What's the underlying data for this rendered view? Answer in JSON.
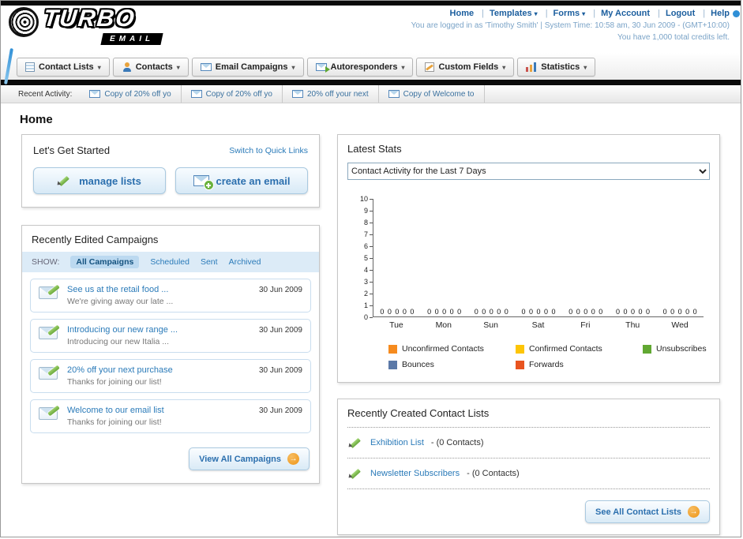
{
  "brand": {
    "name_top": "TURBO",
    "name_bottom": "EMAIL"
  },
  "top_nav": {
    "links": [
      {
        "label": "Home",
        "dropdown": false
      },
      {
        "label": "Templates",
        "dropdown": true
      },
      {
        "label": "Forms",
        "dropdown": true
      },
      {
        "label": "My Account",
        "dropdown": false
      },
      {
        "label": "Logout",
        "dropdown": false
      },
      {
        "label": "Help",
        "dropdown": false
      }
    ]
  },
  "session": {
    "line1": "You are logged in as 'Timothy Smith' | System Time: 10:58 am, 30 Jun 2009 - (GMT+10:00)",
    "line2": "You have 1,000 total credits left."
  },
  "main_nav": {
    "tabs": [
      {
        "label": "Contact Lists",
        "icon": "contact-lists-icon"
      },
      {
        "label": "Contacts",
        "icon": "contacts-icon"
      },
      {
        "label": "Email Campaigns",
        "icon": "email-campaigns-icon"
      },
      {
        "label": "Autoresponders",
        "icon": "autoresponders-icon"
      },
      {
        "label": "Custom Fields",
        "icon": "custom-fields-icon"
      },
      {
        "label": "Statistics",
        "icon": "statistics-icon"
      }
    ]
  },
  "recent_activity": {
    "label": "Recent Activity:",
    "items": [
      "Copy of 20% off yo",
      "Copy of 20% off yo",
      "20% off your next",
      "Copy of Welcome to"
    ]
  },
  "page": {
    "title": "Home"
  },
  "get_started": {
    "title": "Let's Get Started",
    "switch_link": "Switch to Quick Links",
    "manage_lists_label": "manage lists",
    "create_email_label": "create an email"
  },
  "campaigns": {
    "title": "Recently Edited Campaigns",
    "show_label": "SHOW:",
    "filters": [
      "All Campaigns",
      "Scheduled",
      "Sent",
      "Archived"
    ],
    "active_filter": "All Campaigns",
    "items": [
      {
        "title": "See us at the retail food ...",
        "subtitle": "We're giving away our late ...",
        "date": "30 Jun 2009"
      },
      {
        "title": "Introducing our new range ...",
        "subtitle": "Introducing our new Italia ...",
        "date": "30 Jun 2009"
      },
      {
        "title": "20% off your next purchase",
        "subtitle": "Thanks for joining our list!",
        "date": "30 Jun 2009"
      },
      {
        "title": "Welcome to our email list",
        "subtitle": "Thanks for joining our list!",
        "date": "30 Jun 2009"
      }
    ],
    "view_all_label": "View All Campaigns"
  },
  "stats": {
    "title": "Latest Stats",
    "selector_value": "Contact Activity for the Last 7 Days"
  },
  "chart_data": {
    "type": "bar",
    "title": "Contact Activity for the Last 7 Days",
    "categories": [
      "Tue",
      "Mon",
      "Sun",
      "Sat",
      "Fri",
      "Thu",
      "Wed"
    ],
    "series": [
      {
        "name": "Unconfirmed Contacts",
        "color": "#f68b1f",
        "values": [
          0,
          0,
          0,
          0,
          0,
          0,
          0
        ]
      },
      {
        "name": "Confirmed Contacts",
        "color": "#fdc506",
        "values": [
          0,
          0,
          0,
          0,
          0,
          0,
          0
        ]
      },
      {
        "name": "Unsubscribes",
        "color": "#61a832",
        "values": [
          0,
          0,
          0,
          0,
          0,
          0,
          0
        ]
      },
      {
        "name": "Bounces",
        "color": "#5b79a8",
        "values": [
          0,
          0,
          0,
          0,
          0,
          0,
          0
        ]
      },
      {
        "name": "Forwards",
        "color": "#e8541f",
        "values": [
          0,
          0,
          0,
          0,
          0,
          0,
          0
        ]
      }
    ],
    "ylim": [
      0,
      10
    ],
    "ytick_step": 1,
    "grid": false,
    "legend_position": "bottom",
    "value_labels": true
  },
  "contact_lists": {
    "title": "Recently Created Contact Lists",
    "items": [
      {
        "name": "Exhibition List",
        "suffix": "- (0 Contacts)"
      },
      {
        "name": "Newsletter Subscribers",
        "suffix": "- (0 Contacts)"
      }
    ],
    "see_all_label": "See All Contact Lists"
  },
  "colors": {
    "link_blue": "#2b7bb9",
    "accent_orange": "#f0a33c",
    "nav_black": "#111111"
  }
}
